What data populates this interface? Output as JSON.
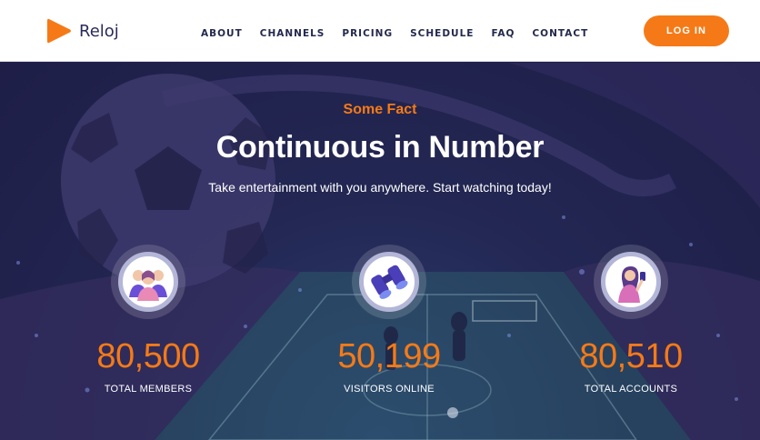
{
  "brand": {
    "name": "Reloj",
    "accent": "#f57a17"
  },
  "nav": {
    "items": [
      {
        "label": "ABOUT"
      },
      {
        "label": "CHANNELS"
      },
      {
        "label": "PRICING"
      },
      {
        "label": "SCHEDULE"
      },
      {
        "label": "FAQ"
      },
      {
        "label": "CONTACT"
      }
    ],
    "login_label": "LOG IN"
  },
  "hero": {
    "eyebrow": "Some Fact",
    "title": "Continuous in Number",
    "subtitle": "Take entertainment with you anywhere. Start watching today!"
  },
  "stats": [
    {
      "value": "80,500",
      "label": "TOTAL MEMBERS",
      "icon": "members-group-icon"
    },
    {
      "value": "50,199",
      "label": "VISITORS ONLINE",
      "icon": "binoculars-icon"
    },
    {
      "value": "80,510",
      "label": "TOTAL ACCOUNTS",
      "icon": "user-with-phone-icon"
    }
  ]
}
